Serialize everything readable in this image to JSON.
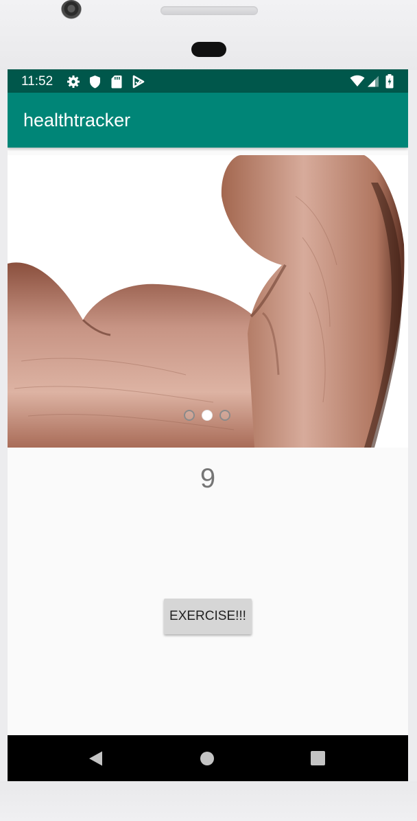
{
  "status_bar": {
    "time": "11:52",
    "left_icons": [
      "settings-icon",
      "shield-icon",
      "sd-card-icon",
      "play-protect-icon"
    ],
    "right_icons": [
      "wifi-icon",
      "cell-signal-icon",
      "battery-icon"
    ]
  },
  "app_bar": {
    "title": "healthtracker"
  },
  "carousel": {
    "image": "flexed-bicep-arm",
    "page_count": 3,
    "active_index": 1
  },
  "counter": {
    "value": "9"
  },
  "exercise_button": {
    "label": "EXERCISE!!!"
  },
  "nav_bar": {
    "buttons": [
      "back-icon",
      "home-icon",
      "recents-icon"
    ]
  },
  "colors": {
    "status_bar": "#00574b",
    "app_bar": "#008577",
    "background": "#fafafa"
  }
}
